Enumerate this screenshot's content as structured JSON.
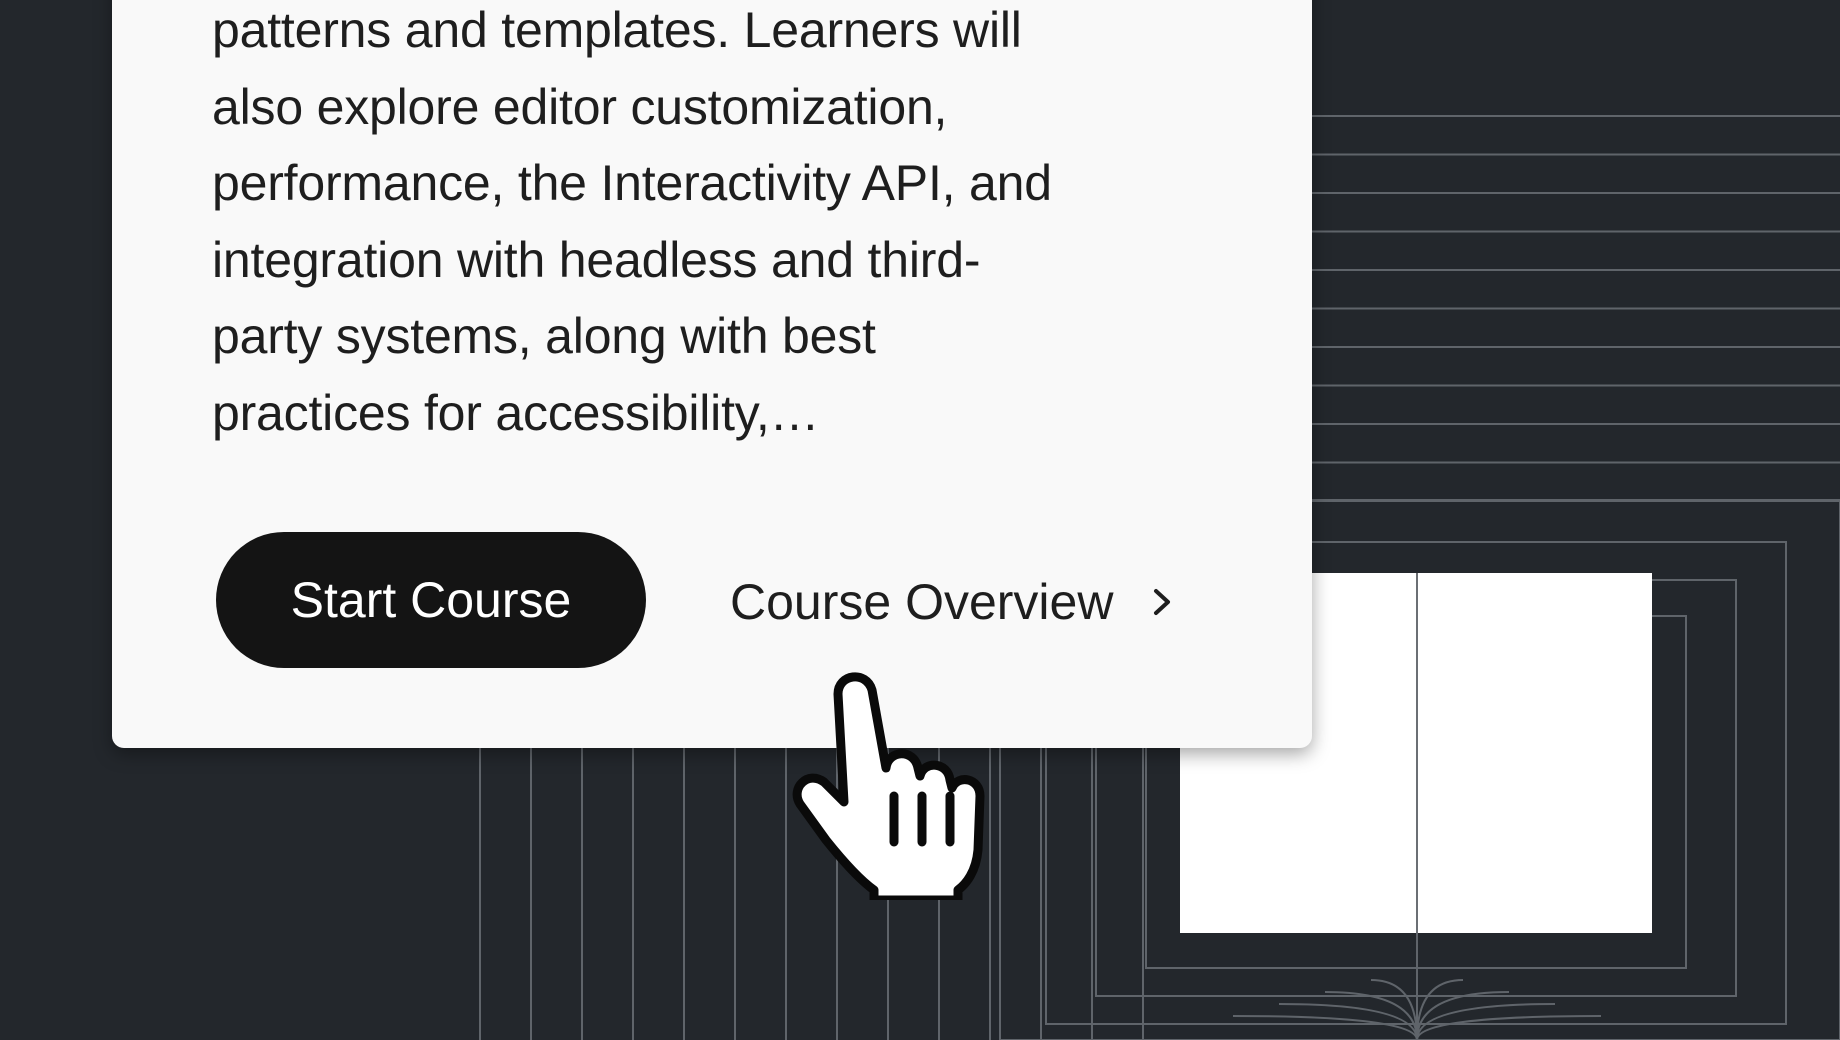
{
  "card": {
    "description_lines": [
      "patterns and templates. Learners will",
      "also explore editor customization,",
      "performance, the Interactivity API, and",
      "integration with headless and third-",
      "party systems, along with best",
      "practices for accessibility,…"
    ],
    "start_button_label": "Start Course",
    "overview_link_label": "Course Overview",
    "overview_link_icon": "chevron-right-icon"
  },
  "colors": {
    "background": "#23272c",
    "card": "#f9f9f9",
    "button": "#141414",
    "line": "#5f646a"
  },
  "cursor_icon": "hand-pointer-icon"
}
